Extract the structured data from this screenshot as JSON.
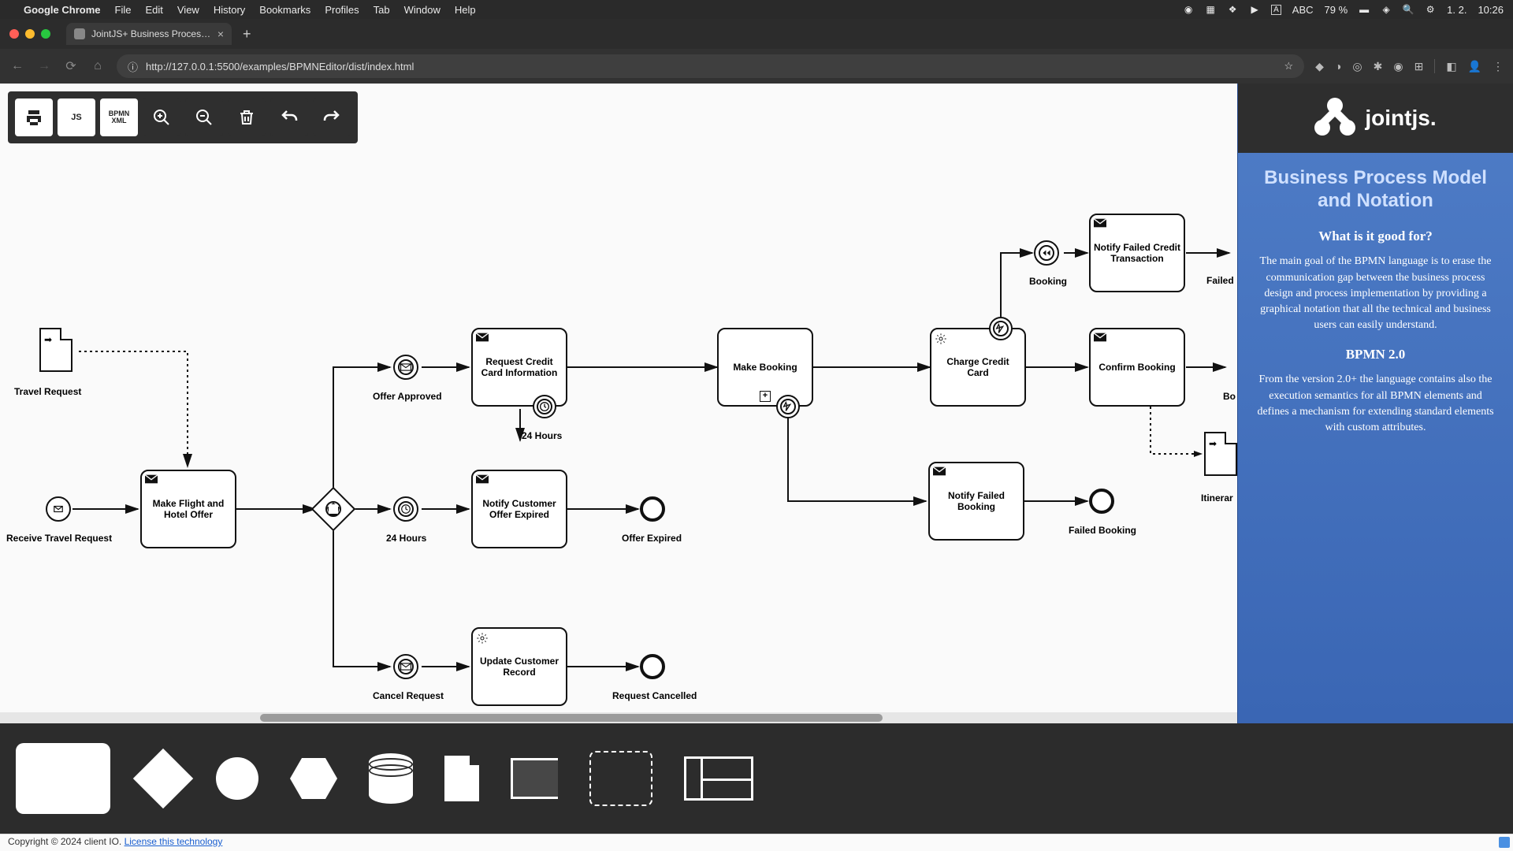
{
  "menubar": {
    "app": "Google Chrome",
    "items": [
      "File",
      "Edit",
      "View",
      "History",
      "Bookmarks",
      "Profiles",
      "Tab",
      "Window",
      "Help"
    ],
    "right": {
      "lang": "ABC",
      "battery": "79 %",
      "date": "1. 2.",
      "time": "10:26"
    }
  },
  "tab": {
    "title": "JointJS+ Business Process M"
  },
  "url": "http://127.0.0.1:5500/examples/BPMNEditor/dist/index.html",
  "toolbar": {
    "print": "print",
    "js": "JS",
    "xml_top": "BPMN",
    "xml_bot": "XML",
    "zoomin": "zoom-in",
    "zoomout": "zoom-out",
    "trash": "delete",
    "undo": "undo",
    "redo": "redo"
  },
  "nodes": {
    "travel_request": "Travel Request",
    "receive_travel": "Receive Travel Request",
    "make_offer": "Make Flight and Hotel Offer",
    "offer_approved": "Offer Approved",
    "hours24_a": "24 Hours",
    "hours24_b": "24 Hours",
    "req_cc": "Request Credit Card Information",
    "notify_expired": "Notify Customer Offer Expired",
    "offer_expired": "Offer Expired",
    "cancel_request": "Cancel Request",
    "update_record": "Update Customer Record",
    "request_cancelled": "Request Cancelled",
    "make_booking": "Make Booking",
    "charge_cc": "Charge Credit Card",
    "booking": "Booking",
    "notify_failed_cc": "Notify Failed Credit Transaction",
    "confirm_booking": "Confirm Booking",
    "notify_failed_booking": "Notify Failed Booking",
    "failed_booking": "Failed Booking",
    "failed": "Failed",
    "bo": "Bo",
    "itinerar": "Itinerar"
  },
  "sidepanel": {
    "brand": "jointjs.",
    "title": "Business Process Model and Notation",
    "q": "What is it good for?",
    "p1": "The main goal of the BPMN language is to erase the communication gap between the business process design and process implementation by providing a graphical notation that all the technical and business users can easily understand.",
    "h2": "BPMN 2.0",
    "p2": "From the version 2.0+ the language contains also the execution semantics for all BPMN elements and defines a mechanism for extending standard elements with custom attributes."
  },
  "footer": {
    "copy": "Copyright © 2024 client IO. ",
    "link": "License this technology"
  }
}
